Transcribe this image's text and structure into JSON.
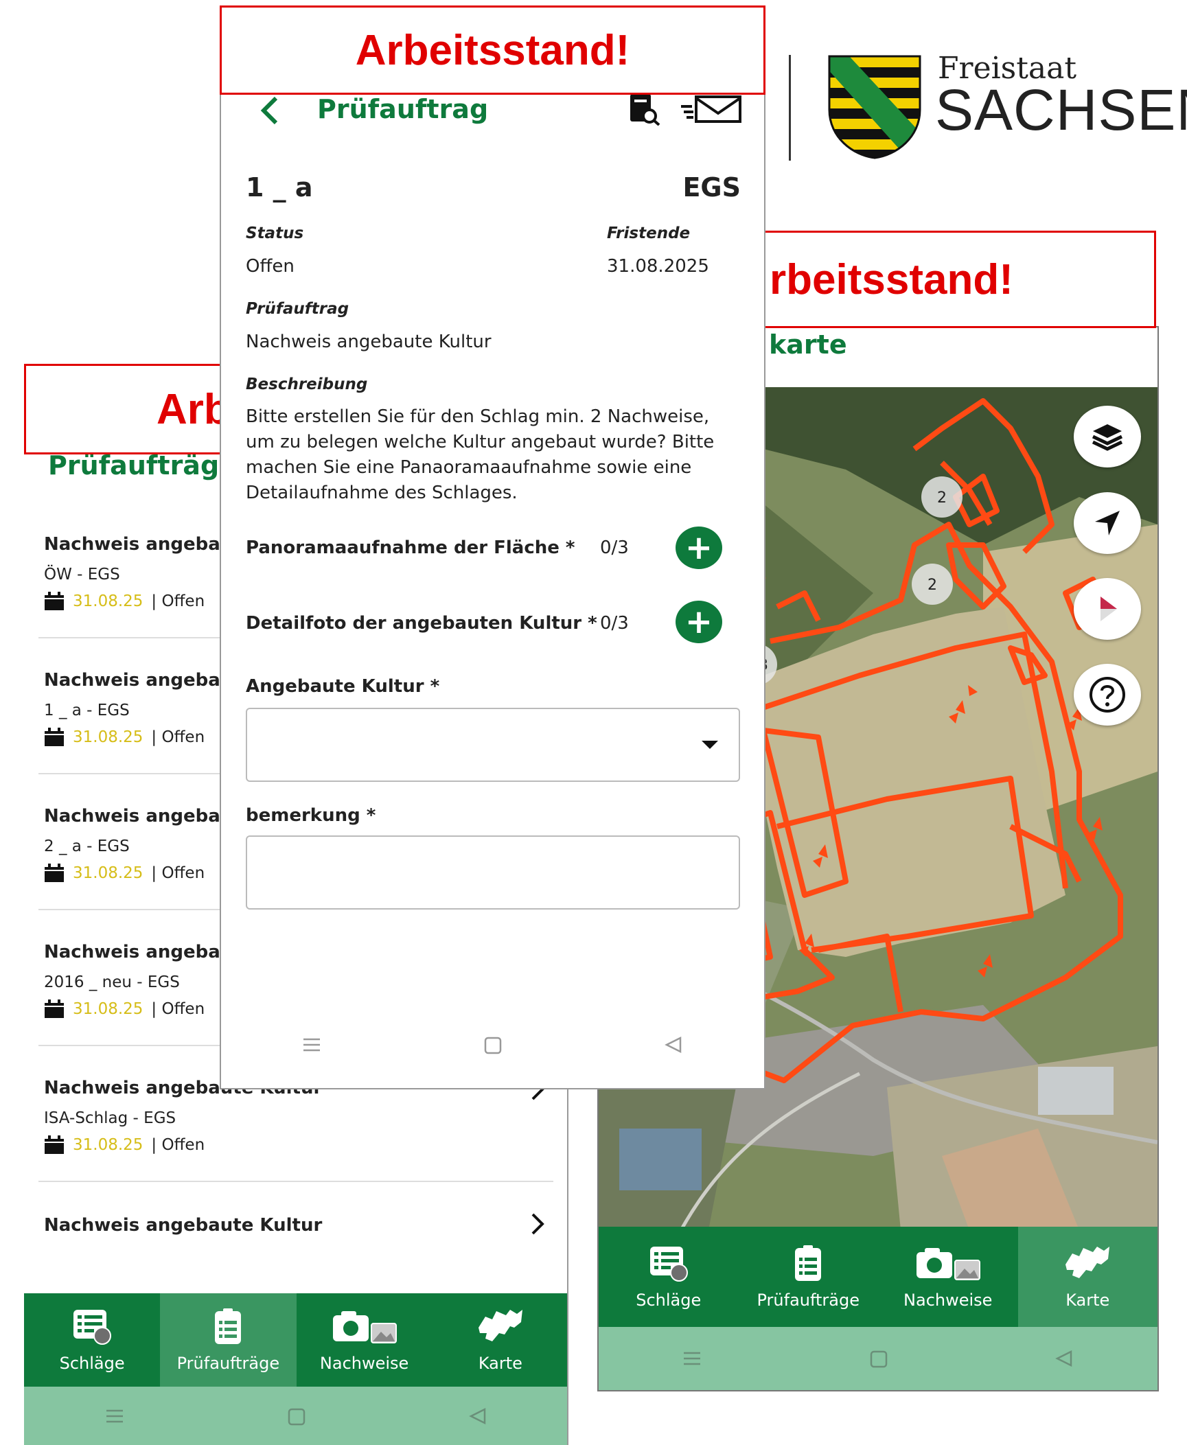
{
  "banners": {
    "text": "Arbeitsstand!",
    "left_fragment": "Arb",
    "right_fragment": "rbeitsstand!"
  },
  "logo": {
    "line1": "Freistaat",
    "line2": "SACHSEN"
  },
  "list_screen": {
    "title": "Prüfaufträge",
    "items": [
      {
        "title": "Nachweis angebau",
        "sub": "ÖW - EGS",
        "date": "31.08.25",
        "status": "| Offen"
      },
      {
        "title": "Nachweis angebau",
        "sub": "1 _ a - EGS",
        "date": "31.08.25",
        "status": "| Offen"
      },
      {
        "title": "Nachweis angebau",
        "sub": "2 _ a - EGS",
        "date": "31.08.25",
        "status": "| Offen"
      },
      {
        "title": "Nachweis angebau",
        "sub": "2016 _ neu - EGS",
        "date": "31.08.25",
        "status": "| Offen"
      },
      {
        "title": "Nachweis angebaute Kultur",
        "sub": "ISA-Schlag - EGS",
        "date": "31.08.25",
        "status": "| Offen"
      },
      {
        "title": "Nachweis angebaute Kultur",
        "sub": "",
        "date": "",
        "status": ""
      }
    ]
  },
  "nav": {
    "schlaege": "Schläge",
    "pruefauftraege": "Prüfaufträge",
    "nachweise": "Nachweise",
    "karte": "Karte"
  },
  "detail_screen": {
    "back": "<",
    "title": "Prüfauftrag",
    "id": "1 _ a",
    "type": "EGS",
    "status_label": "Status",
    "status_value": "Offen",
    "deadline_label": "Fristende",
    "deadline_value": "31.08.2025",
    "order_label": "Prüfauftrag",
    "order_value": "Nachweis angebaute Kultur",
    "desc_label": "Beschreibung",
    "desc_value": "Bitte erstellen Sie für den Schlag min. 2 Nachweise, um zu belegen welche Kultur angebaut wurde? Bitte machen Sie eine Panaoramaaufnahme sowie eine Detailaufnahme des Schlages.",
    "panorama_label": "Panoramaaufnahme der Fläche *",
    "panorama_count": "0/3",
    "detail_label": "Detailfoto der angebauten Kultur *",
    "detail_count": "0/3",
    "culture_label": "Angebaute Kultur *",
    "remark_label": "bemerkung *"
  },
  "map_screen": {
    "title_fragment": "karte",
    "cluster_labels": [
      "2",
      "2",
      "3"
    ]
  },
  "colors": {
    "green": "#0e7a3c",
    "red": "#e00000",
    "yellow": "#d6bd18",
    "field": "#ff4a14"
  }
}
